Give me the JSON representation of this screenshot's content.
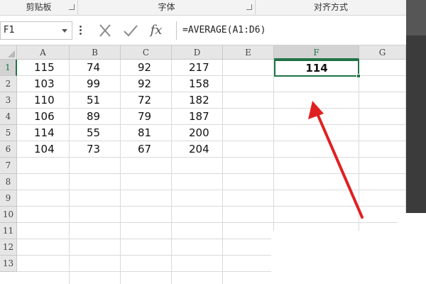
{
  "ribbon": {
    "groups": [
      {
        "label": "剪贴板"
      },
      {
        "label": "字体"
      },
      {
        "label": "对齐方式"
      }
    ]
  },
  "formula_bar": {
    "name_box": "F1",
    "formula": "=AVERAGE(A1:D6)",
    "fx_label": "fx"
  },
  "columns": [
    "A",
    "B",
    "C",
    "D",
    "E",
    "F",
    "G"
  ],
  "rows": [
    "1",
    "2",
    "3",
    "4",
    "5",
    "6",
    "7",
    "8",
    "9",
    "10",
    "11",
    "12",
    "13"
  ],
  "data": [
    [
      "115",
      "74",
      "92",
      "217"
    ],
    [
      "103",
      "99",
      "92",
      "158"
    ],
    [
      "110",
      "51",
      "72",
      "182"
    ],
    [
      "106",
      "89",
      "79",
      "187"
    ],
    [
      "114",
      "55",
      "81",
      "200"
    ],
    [
      "104",
      "73",
      "67",
      "204"
    ]
  ],
  "active_cell": {
    "ref": "F1",
    "value": "114"
  },
  "colors": {
    "selection": "#217346",
    "arrow": "#e02020",
    "header_bg": "#e6e6e6"
  }
}
